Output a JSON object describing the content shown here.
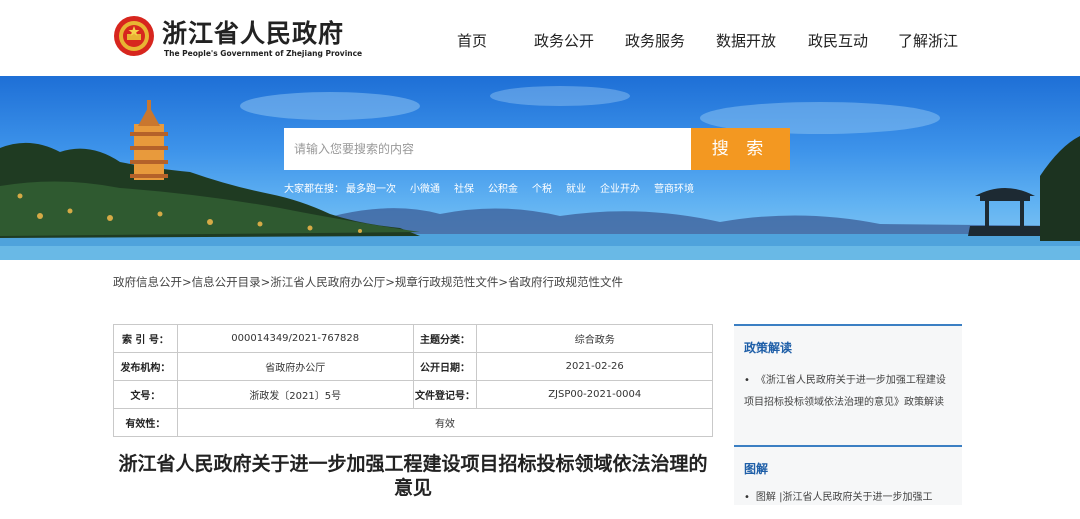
{
  "header": {
    "logo_cn": "浙江省人民政府",
    "logo_en": "The People's Government of Zhejiang Province",
    "nav": [
      "首页",
      "政务公开",
      "政务服务",
      "数据开放",
      "政民互动",
      "了解浙江"
    ]
  },
  "search": {
    "placeholder": "请输入您要搜索的内容",
    "button": "搜 索",
    "hot_label": "大家都在搜：",
    "hot_terms": [
      "最多跑一次",
      "小微通",
      "社保",
      "公积金",
      "个税",
      "就业",
      "企业开办",
      "营商环境"
    ]
  },
  "breadcrumb": [
    "政府信息公开",
    "信息公开目录",
    "浙江省人民政府办公厅",
    "规章行政规范性文件",
    "省政府行政规范性文件"
  ],
  "info_table": {
    "index_label": "索 引 号：",
    "index_value": "000014349/2021-767828",
    "category_label": "主题分类：",
    "category_value": "综合政务",
    "agency_label": "发布机构：",
    "agency_value": "省政府办公厅",
    "date_label": "公开日期：",
    "date_value": "2021-02-26",
    "docno_label": "文号：",
    "docno_value": "浙政发〔2021〕5号",
    "regno_label": "文件登记号：",
    "regno_value": "ZJSP00-2021-0004",
    "validity_label": "有效性：",
    "validity_value": "有效"
  },
  "doc_title": "浙江省人民政府关于进一步加强工程建设项目招标投标领域依法治理的意见",
  "sidebar": {
    "policy_title": "政策解读",
    "policy_item": "《浙江省人民政府关于进一步加强工程建设项目招标投标领域依法治理的意见》政策解读",
    "graphic_title": "图解",
    "graphic_item": "图解 |浙江省人民政府关于进一步加强工"
  },
  "colors": {
    "accent_orange": "#f39821",
    "sidebar_blue": "#1f5fa8",
    "banner_blue": "#3d93ea"
  }
}
